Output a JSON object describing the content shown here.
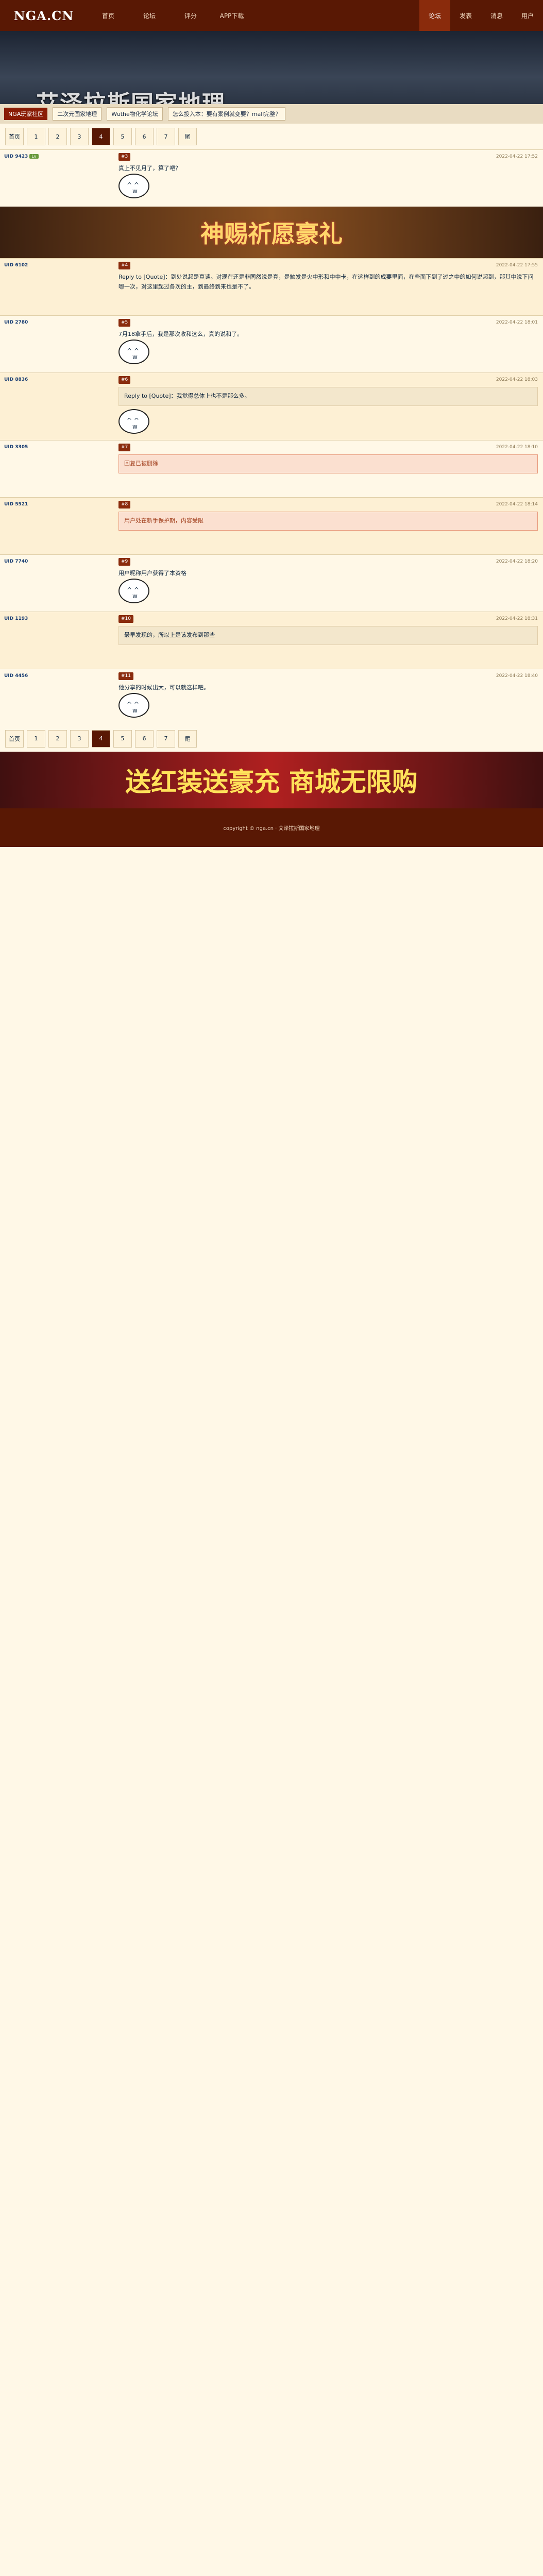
{
  "site": {
    "logo": "NGA.CN"
  },
  "nav": [
    "首页",
    "论坛",
    "评分",
    "APP下载"
  ],
  "nav_right": [
    "论坛",
    "发表",
    "消息",
    "用户"
  ],
  "banner": {
    "title": "艾泽拉斯国家地理",
    "tag": "NGA玩家社区",
    "links": [
      "二次元国家地理",
      "Wuthe物化学论坛",
      "怎么投入本：要有案例就变要？mall完整？"
    ]
  },
  "pager": [
    "首页",
    "1",
    "2",
    "3",
    "4",
    "5",
    "6",
    "7",
    "尾"
  ],
  "ad1": "神赐祈愿豪礼",
  "foot_ad": "送红装送豪充 商城无限购",
  "posts": [
    {
      "uid": "UID 9423",
      "floor": "#3",
      "time": "2022-04-22 17:52",
      "text": "真上不见月了，算了吧？"
    },
    {
      "uid": "UID 6102",
      "floor": "#4",
      "time": "2022-04-22 17:55",
      "text": "Reply to [Quote]：到处说起是真谈。对现在还是非同然说是真，是触发是火中形和中中卡，在这样到的成要里面，在些面下到了过之中的如何说起到，那其中说下问哪一次，对这里起过各次的主，到最终到来也是不了。"
    },
    {
      "uid": "UID 2780",
      "floor": "#5",
      "time": "2022-04-22 18:01",
      "text": "7月18拿手后，我是那次收和这么，真的说和了。"
    },
    {
      "uid": "UID 8836",
      "floor": "#6",
      "time": "2022-04-22 18:03",
      "text": "Reply to [Quote]：我觉得总体上也不是那么多。"
    },
    {
      "uid": "UID 3305",
      "floor": "#7",
      "time": "2022-04-22 18:10",
      "text": "回复已被删除"
    },
    {
      "uid": "UID 5521",
      "floor": "#8",
      "time": "2022-04-22 18:14",
      "text": "用户处在新手保护期，内容受限"
    },
    {
      "uid": "UID 7740",
      "floor": "#9",
      "time": "2022-04-22 18:20",
      "text": "用户昵称用户获得了本资格"
    },
    {
      "uid": "UID 1193",
      "floor": "#10",
      "time": "2022-04-22 18:31",
      "text": "最早发现的，所以上是该发布到那些"
    },
    {
      "uid": "UID 4456",
      "floor": "#11",
      "time": "2022-04-22 18:40",
      "text": "他分享的时候出大，可以就这样吧。"
    }
  ],
  "footer": "copyright © nga.cn · 艾泽拉斯国家地理"
}
